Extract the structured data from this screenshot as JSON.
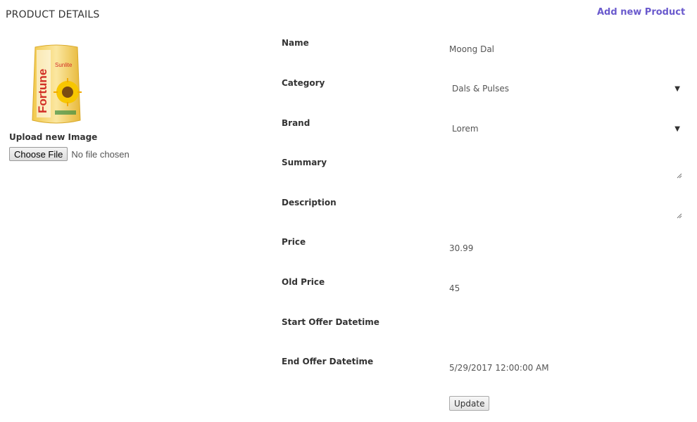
{
  "header": {
    "title": "PRODUCT DETAILS",
    "add_link": "Add new Product"
  },
  "image_panel": {
    "upload_label": "Upload new Image",
    "choose_button": "Choose File",
    "file_status": "No file chosen"
  },
  "form": {
    "name_label": "Name",
    "name_value": "Moong Dal",
    "category_label": "Category",
    "category_value": "Dals & Pulses",
    "brand_label": "Brand",
    "brand_value": "Lorem",
    "summary_label": "Summary",
    "summary_value": "",
    "description_label": "Description",
    "description_value": "",
    "price_label": "Price",
    "price_value": "30.99",
    "old_price_label": "Old Price",
    "old_price_value": "45",
    "start_offer_label": "Start Offer Datetime",
    "start_offer_value": "",
    "end_offer_label": "End Offer Datetime",
    "end_offer_value": "5/29/2017 12:00:00 AM",
    "update_button": "Update"
  },
  "colors": {
    "link": "#6a5acd",
    "label": "#333333",
    "value": "#555555"
  }
}
